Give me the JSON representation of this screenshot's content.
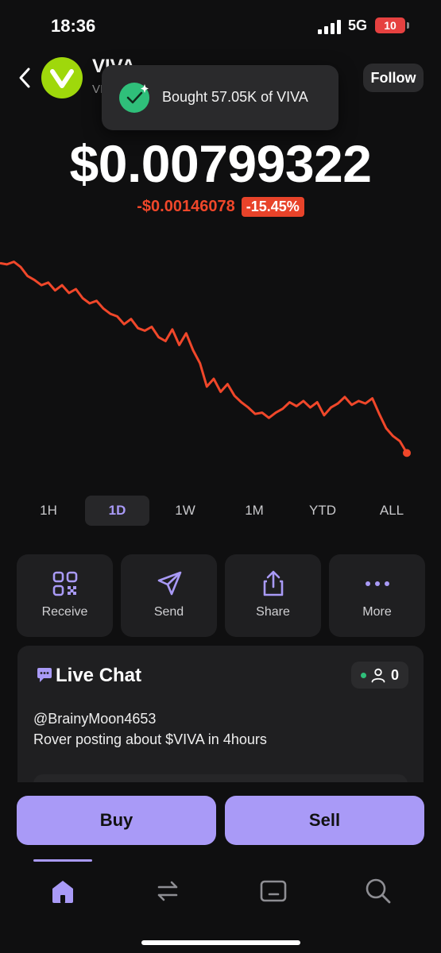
{
  "status_bar": {
    "time": "18:36",
    "network": "5G",
    "battery": "10"
  },
  "header": {
    "token_name": "VIVA",
    "token_sub": "VI",
    "follow_label": "Follow"
  },
  "toast": {
    "text": "Bought 57.05K of VIVA"
  },
  "price": {
    "value": "$0.00799322",
    "change_abs": "-$0.00146078",
    "change_pct": "-15.45%"
  },
  "colors": {
    "accent": "#a99af7",
    "negative": "#f0472a",
    "logo": "#9fd80b",
    "success": "#2fbf7a"
  },
  "range_tabs": {
    "items": [
      "1H",
      "1D",
      "1W",
      "1M",
      "YTD",
      "ALL"
    ],
    "selected": "1D"
  },
  "actions": [
    {
      "label": "Receive",
      "icon": "qr-code-icon"
    },
    {
      "label": "Send",
      "icon": "send-icon"
    },
    {
      "label": "Share",
      "icon": "share-icon"
    },
    {
      "label": "More",
      "icon": "more-dots-icon"
    }
  ],
  "chat": {
    "title": "Live Chat",
    "viewer_count": "0",
    "messages": [
      {
        "user": "@BrainyMoon4653",
        "text": "Rover posting about $VIVA in 4hours"
      }
    ]
  },
  "trade": {
    "buy_label": "Buy",
    "sell_label": "Sell"
  },
  "nav": {
    "items": [
      "home-icon",
      "swap-icon",
      "wallet-icon",
      "search-icon"
    ],
    "selected": "home-icon"
  },
  "chart_data": {
    "type": "line",
    "title": "",
    "xlabel": "",
    "ylabel": "",
    "grid": false,
    "series": [
      {
        "values": [
          0.00945,
          0.00944,
          0.00946,
          0.00942,
          0.00935,
          0.00932,
          0.00928,
          0.0093,
          0.00924,
          0.00928,
          0.00922,
          0.00925,
          0.00918,
          0.00914,
          0.00916,
          0.0091,
          0.00906,
          0.00904,
          0.00898,
          0.00902,
          0.00895,
          0.00893,
          0.00896,
          0.00888,
          0.00885,
          0.00894,
          0.00882,
          0.00891,
          0.00878,
          0.00868,
          0.0085,
          0.00856,
          0.00846,
          0.00852,
          0.00843,
          0.00838,
          0.00834,
          0.00829,
          0.0083,
          0.00826,
          0.0083,
          0.00833,
          0.00838,
          0.00835,
          0.00839,
          0.00834,
          0.00838,
          0.00828,
          0.00834,
          0.00837,
          0.00842,
          0.00836,
          0.00839,
          0.00837,
          0.00841,
          0.00829,
          0.00818,
          0.00812,
          0.00808,
          0.00799
        ]
      }
    ]
  }
}
